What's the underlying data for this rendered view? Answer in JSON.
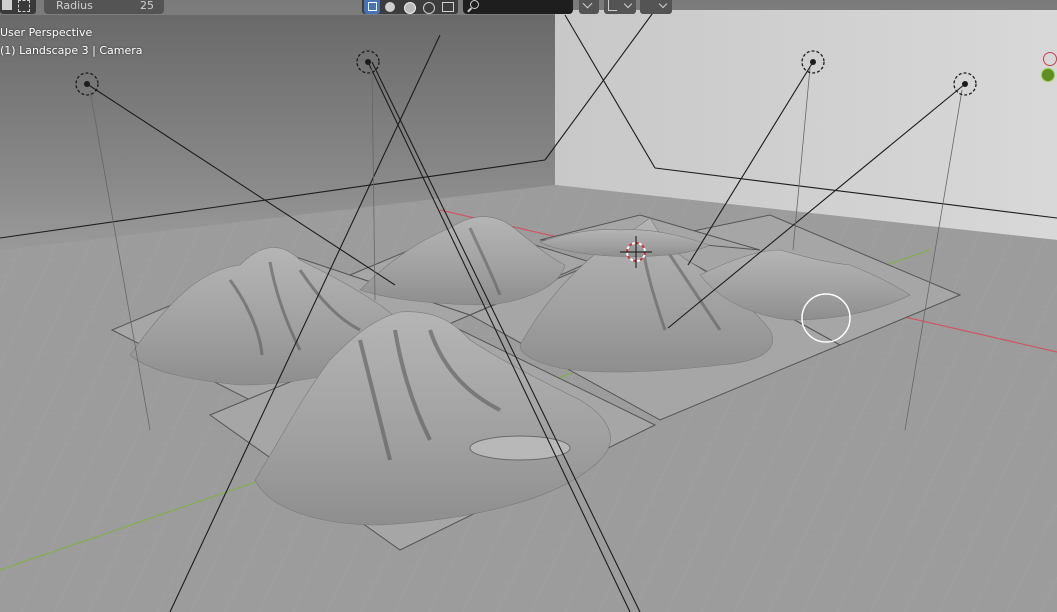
{
  "header": {
    "property_label": "Radius",
    "property_value": "25",
    "search_placeholder": ""
  },
  "viewport": {
    "view_name": "User Perspective",
    "object_info": "(1) Landscape 3 | Camera"
  },
  "colors": {
    "header_bg": "#3c3c3c",
    "field_bg": "#1e1e1e",
    "active_blue": "#4772b3",
    "axis_x": "#d9495c",
    "axis_y": "#7fb23f",
    "gizmo_red": "#c8424e",
    "gizmo_green": "#5f8f22"
  },
  "icons": [
    "tool-icon",
    "select-box-icon",
    "solid-shading-icon",
    "material-preview-icon",
    "rendered-shading-icon",
    "wireframe-icon",
    "gizmo-icon",
    "search-icon",
    "chevron-down-icon",
    "pivot-icon",
    "snap-dropdown-icon"
  ]
}
